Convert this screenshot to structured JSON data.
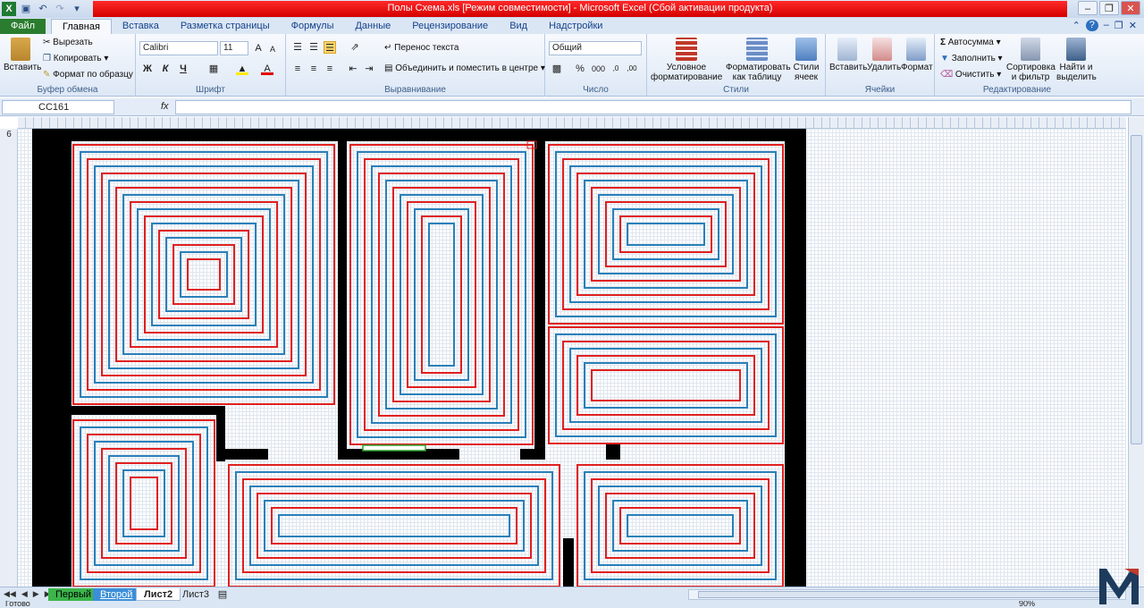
{
  "window": {
    "title": "Полы Схема.xls  [Режим совместимости]  -  Microsoft Excel (Сбой активации продукта)"
  },
  "tabs": [
    {
      "label": "Файл"
    },
    {
      "label": "Главная"
    },
    {
      "label": "Вставка"
    },
    {
      "label": "Разметка страницы"
    },
    {
      "label": "Формулы"
    },
    {
      "label": "Данные"
    },
    {
      "label": "Рецензирование"
    },
    {
      "label": "Вид"
    },
    {
      "label": "Надстройки"
    }
  ],
  "ribbon": {
    "clipboard": {
      "label": "Буфер обмена",
      "paste": "Вставить",
      "cut": "Вырезать",
      "copy": "Копировать",
      "format_painter": "Формат по образцу"
    },
    "font": {
      "label": "Шрифт",
      "font_name": "Calibri",
      "font_size": "11",
      "bold": "Ж",
      "italic": "К",
      "underline": "Ч"
    },
    "alignment": {
      "label": "Выравнивание",
      "wrap_text": "Перенос текста",
      "merge_center": "Объединить и поместить в центре"
    },
    "number": {
      "label": "Число",
      "format": "Общий"
    },
    "styles": {
      "label": "Стили",
      "conditional_line1": "Условное",
      "conditional_line2": "форматирование",
      "table_line1": "Форматировать",
      "table_line2": "как таблицу",
      "cell_line1": "Стили",
      "cell_line2": "ячеек"
    },
    "cells": {
      "label": "Ячейки",
      "insert": "Вставить",
      "delete": "Удалить",
      "format": "Формат"
    },
    "editing": {
      "label": "Редактирование",
      "autosum": "Автосумма",
      "fill": "Заполнить",
      "clear": "Очистить",
      "sort_line1": "Сортировка",
      "sort_line2": "и фильтр",
      "find_line1": "Найти и",
      "find_line2": "выделить"
    }
  },
  "formula_bar": {
    "name_box": "CC161",
    "fx": "fx",
    "formula": ""
  },
  "grid": {
    "row_number": "6"
  },
  "sheets": [
    {
      "label": "Первый",
      "color": "#3bb54a"
    },
    {
      "label": "Второй",
      "color": "#3b8fd9"
    },
    {
      "label": "Лист2",
      "color": "#ffffff"
    },
    {
      "label": "Лист3",
      "color": "#dbe6f4"
    }
  ],
  "status": {
    "ready": "Готово",
    "zoom": "90%"
  },
  "colors": {
    "pipe_red": "#e02020",
    "pipe_blue": "#2a80b9",
    "wall": "#000000",
    "title_band": "#e00000"
  }
}
